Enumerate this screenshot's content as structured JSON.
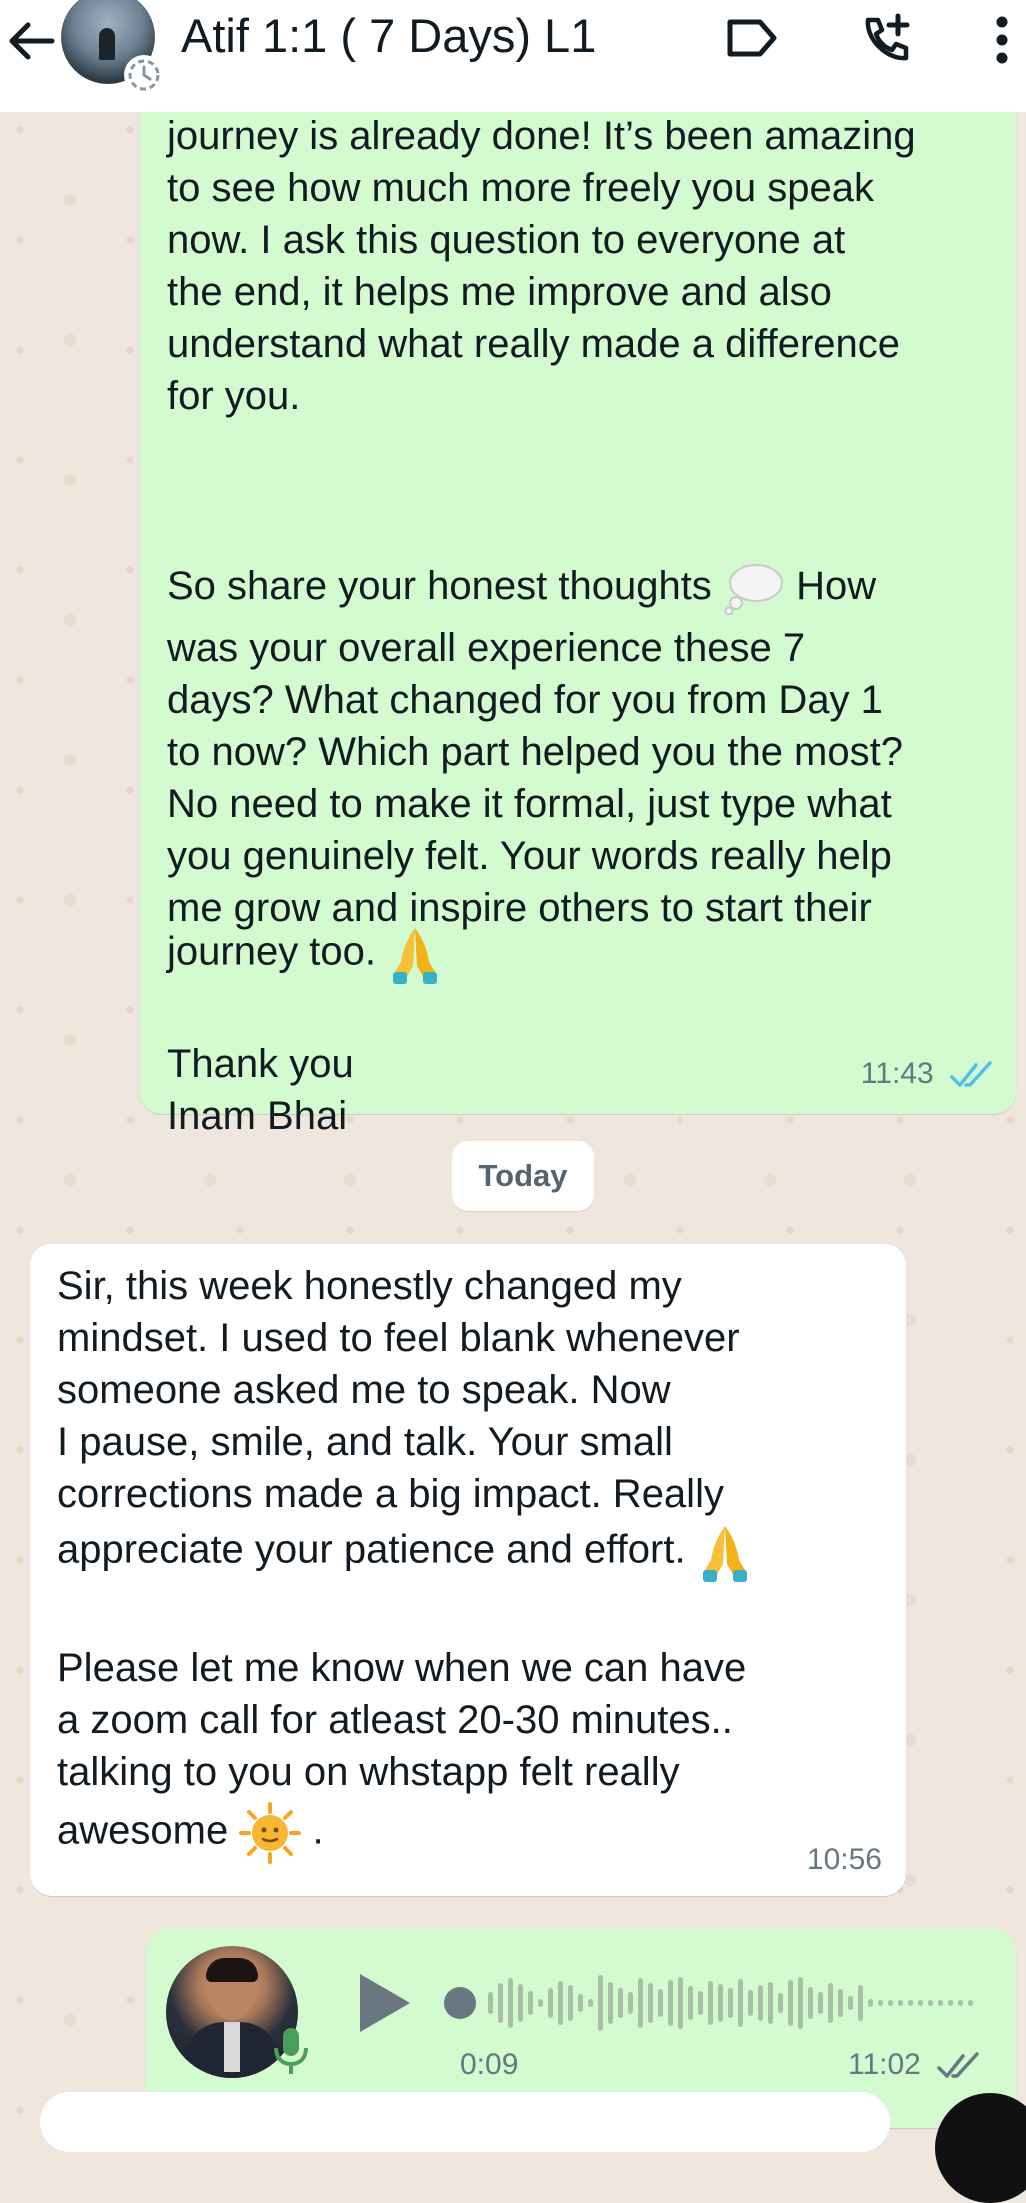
{
  "header": {
    "title": "Atif 1:1 ( 7 Days) L1"
  },
  "messages": {
    "outgoing_1": {
      "paragraph_1": "journey is already done! It’s been amazing\nto see how much more freely you speak\nnow. I ask this question to everyone at\nthe end, it helps me improve and also\nunderstand what really made a difference\nfor you.",
      "paragraph_2_lead": "So share your honest thoughts",
      "paragraph_2_after_emoji": " How",
      "paragraph_2_body": "was your overall experience these 7\ndays? What changed for you from Day 1\nto now? Which part helped you the most?\nNo need to make it formal, just type what\nyou genuinely felt. Your words really help\nme grow and inspire others to start their",
      "paragraph_2_end": "journey too.",
      "paragraph_3": "Thank you\nInam Bhai",
      "time": "11:43",
      "emoji_1": "thought-balloon-icon",
      "emoji_2": "folded-hands-icon"
    },
    "date_divider": "Today",
    "incoming_1": {
      "paragraph_1": "Sir, this week honestly changed my\nmindset. I used to feel blank whenever\nsomeone asked me to speak. Now\nI pause, smile, and talk. Your small\ncorrections made a big impact. Really",
      "paragraph_1_end": "appreciate your patience and effort.",
      "paragraph_2": "Please let me know when we can have\na zoom call for atleast 20-30 minutes..\ntalking to you on whstapp felt really",
      "paragraph_2_end": "awesome",
      "paragraph_2_tail": ".",
      "time": "10:56",
      "emoji_1": "folded-hands-icon",
      "emoji_2": "sun-with-face-icon"
    },
    "voice_note": {
      "duration": "0:09",
      "time": "11:02",
      "progress": 0
    }
  },
  "colors": {
    "outgoing_bubble": "#d3fbcf",
    "incoming_bubble": "#ffffff",
    "read_ticks": "#53bdeb",
    "chat_background": "#efe7dd"
  }
}
